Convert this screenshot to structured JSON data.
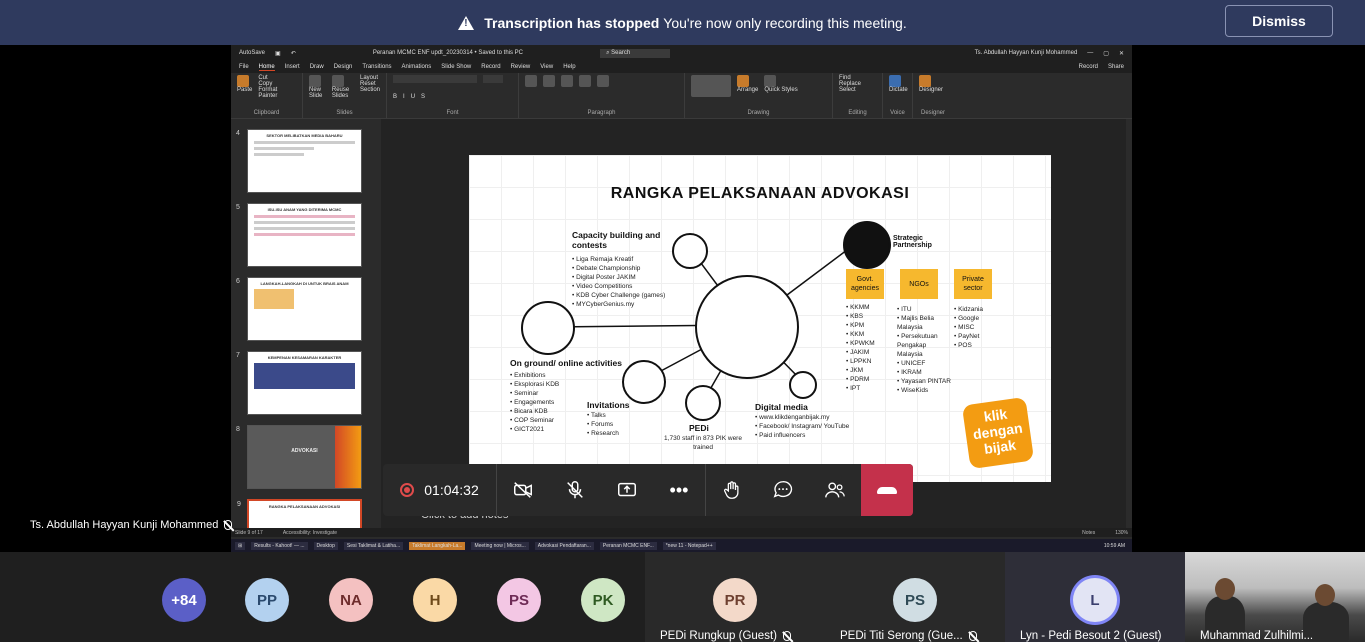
{
  "banner": {
    "bold_text": "Transcription has stopped",
    "text": "You're now only recording this meeting.",
    "dismiss_label": "Dismiss"
  },
  "ppt": {
    "autosave": "AutoSave",
    "file_title": "Peranan MCMC ENF updt_20230314 • Saved to this PC",
    "search_placeholder": "Search",
    "user": "Ts. Abdullah Hayyan Kunji Mohammed",
    "record_btn": "Record",
    "share_btn": "Share",
    "tabs": [
      "File",
      "Home",
      "Insert",
      "Draw",
      "Design",
      "Transitions",
      "Animations",
      "Slide Show",
      "Record",
      "Review",
      "View",
      "Help"
    ],
    "active_tab": "Home",
    "ribbon_groups": [
      "Clipboard",
      "Slides",
      "Font",
      "Paragraph",
      "Drawing",
      "Editing",
      "Voice",
      "Designer"
    ],
    "ribbon_buttons": {
      "paste": "Paste",
      "cut": "Cut",
      "copy": "Copy",
      "format_painter": "Format Painter",
      "new_slide": "New Slide",
      "reuse_slides": "Reuse Slides",
      "layout": "Layout",
      "reset": "Reset",
      "section": "Section",
      "arrange": "Arrange",
      "quick_styles": "Quick Styles",
      "find": "Find",
      "replace": "Replace",
      "select": "Select",
      "dictate": "Dictate",
      "designer": "Designer"
    },
    "thumbnails": [
      {
        "num": "4",
        "title": "SEKTOR MELIBATKAN MEDIA BAHARU"
      },
      {
        "num": "5",
        "title": "ISU-ISU ANAM YANG DITERIMA MCMC"
      },
      {
        "num": "6",
        "title": "LANGKAH-LANGKAH DI UNTUK BRAIS ANAM"
      },
      {
        "num": "7",
        "title": "KEMPENAN KESAMARAN KARAKTER"
      },
      {
        "num": "8",
        "title": "ADVOKASI"
      },
      {
        "num": "9",
        "title": "RANGKA PELAKSANAAN ADVOKASI"
      }
    ],
    "notes_placeholder": "Click to add notes",
    "status": {
      "slide": "Slide 9 of 17",
      "accessibility": "Accessibility: Investigate",
      "notes": "Notes",
      "zoom": "130%"
    },
    "taskbar": [
      "Results - Kahoot! — ...",
      "Desktop",
      "Sesi Taklimat & Latiha...",
      "Taklimat Langkah-La...",
      "Meeting now | Micros...",
      "Advokasi Pendaftaran...",
      "Peranan MCMC ENF...",
      "*new 11 - Notepad++"
    ],
    "clock": "10:59 AM"
  },
  "slide": {
    "title": "RANGKA PELAKSANAAN ADVOKASI",
    "capacity": {
      "heading": "Capacity building and contests",
      "items": [
        "Liga Remaja Kreatif",
        "Debate Championship",
        "Digital Poster JAKIM",
        "Video Competitions",
        "KDB Cyber Challenge (games)",
        "MYCyberGenius.my"
      ]
    },
    "ground": {
      "heading": "On ground/ online activities",
      "items": [
        "Exhibitions",
        "Eksplorasi KDB",
        "Seminar",
        "Engagements",
        "Bicara KDB",
        "COP Seminar",
        "GICT2021"
      ]
    },
    "invitations": {
      "heading": "Invitations",
      "items": [
        "Talks",
        "Forums",
        "Research"
      ]
    },
    "pedi": {
      "heading": "PEDi",
      "text": "1,730 staff in 873 PIK were trained"
    },
    "digital": {
      "heading": "Digital media",
      "items": [
        "www.klikdenganbijak.my",
        "Facebook/ Instagram/ YouTube",
        "Paid influencers"
      ]
    },
    "strategic": {
      "heading": "Strategic Partnership"
    },
    "govt": {
      "label": "Govt. agencies",
      "items": [
        "KKMM",
        "KBS",
        "KPM",
        "KKM",
        "KPWKM",
        "JAKIM",
        "LPPKN",
        "JKM",
        "PDRM",
        "IPT"
      ]
    },
    "ngos": {
      "label": "NGOs",
      "items": [
        "ITU",
        "Majlis Belia Malaysia",
        "Persekutuan Pengakap Malaysia",
        "UNICEF",
        "IKRAM",
        "Yayasan PINTAR",
        "WiseKids"
      ]
    },
    "private": {
      "label": "Private sector",
      "items": [
        "Kidzania",
        "Google",
        "MISC",
        "PayNet",
        "POS"
      ]
    },
    "logo": "klik dengan bijak"
  },
  "presenter": {
    "name": "Ts. Abdullah Hayyan Kunji Mohammed"
  },
  "callbar": {
    "timer": "01:04:32"
  },
  "gallery": {
    "overflow_count": "+84",
    "avatars": [
      {
        "initials": "PP",
        "bg": "#b3d1ef",
        "fg": "#2b4a6e"
      },
      {
        "initials": "NA",
        "bg": "#f4c1c1",
        "fg": "#6e2b2b"
      },
      {
        "initials": "H",
        "bg": "#fad9a6",
        "fg": "#6e4a1a"
      },
      {
        "initials": "PS",
        "bg": "#f3c7e4",
        "fg": "#6e2b56"
      },
      {
        "initials": "PK",
        "bg": "#cfe7c4",
        "fg": "#2f5a22"
      }
    ],
    "tiles": [
      {
        "initials": "PR",
        "name": "PEDi Rungkup (Guest)",
        "bg": "#f3d9c9",
        "fg": "#6e4030"
      },
      {
        "initials": "PS",
        "name": "PEDi Titi Serong (Gue...",
        "bg": "#d0dde3",
        "fg": "#2f4a56"
      },
      {
        "initials": "L",
        "name": "Lyn - Pedi Besout 2 (Guest)",
        "bg": "#e2e4f4",
        "fg": "#3b3f6e"
      }
    ],
    "video_name": "Muhammad Zulhilmi...",
    "colors": {
      "overflow_bg": "#5b5fc7",
      "ring": "#7f85f5"
    }
  }
}
